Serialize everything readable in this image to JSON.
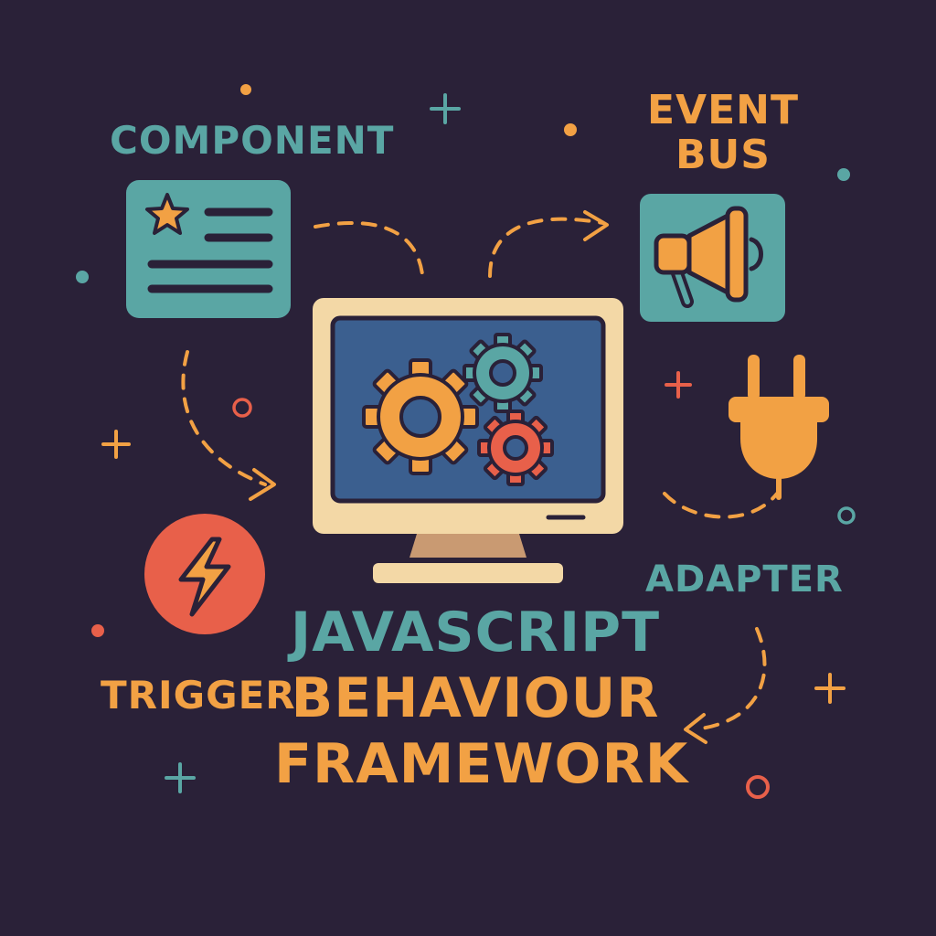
{
  "labels": {
    "component": "COMPONENT",
    "event_bus_line1": "EVENT",
    "event_bus_line2": "BUS",
    "adapter": "ADAPTER",
    "trigger": "TRIGGER"
  },
  "title": {
    "line1": "JAVASCRIPT",
    "line2": "BEHAVIOUR",
    "line3": "FRAMEWORK"
  },
  "icons": {
    "component": "component-card-icon",
    "event_bus": "megaphone-icon",
    "adapter": "plug-icon",
    "trigger": "lightning-icon",
    "center": "monitor-gears-icon"
  },
  "colors": {
    "background": "#2a2138",
    "teal": "#5aa6a4",
    "orange": "#f2a144",
    "red": "#e8604a",
    "cream": "#f3d8a6",
    "screen": "#3b5f8f"
  }
}
